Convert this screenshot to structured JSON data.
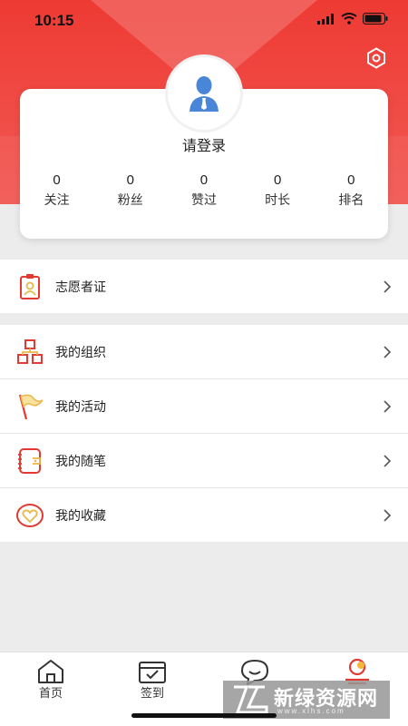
{
  "status_bar": {
    "time": "10:15"
  },
  "colors": {
    "brand": "#ee3a33",
    "brand_light": "#f47f7c",
    "icon_gold": "#e8b84a",
    "avatar_blue": "#4a86d8"
  },
  "profile": {
    "avatar_icon": "user-icon",
    "login_label": "请登录",
    "stats": [
      {
        "value": "0",
        "label": "关注"
      },
      {
        "value": "0",
        "label": "粉丝"
      },
      {
        "value": "0",
        "label": "赞过"
      },
      {
        "value": "0",
        "label": "时长"
      },
      {
        "value": "0",
        "label": "排名"
      }
    ]
  },
  "settings": {
    "icon": "gear-icon"
  },
  "menu": {
    "certificate": {
      "label": "志愿者证",
      "icon": "id-badge-icon"
    },
    "items": [
      {
        "label": "我的组织",
        "icon": "org-chart-icon"
      },
      {
        "label": "我的活动",
        "icon": "flag-icon"
      },
      {
        "label": "我的随笔",
        "icon": "notebook-icon"
      },
      {
        "label": "我的收藏",
        "icon": "heart-icon"
      }
    ]
  },
  "tabbar": {
    "tabs": [
      {
        "label": "首页",
        "icon": "home-icon"
      },
      {
        "label": "签到",
        "icon": "checkin-icon"
      },
      {
        "label": "",
        "icon": "chat-icon"
      },
      {
        "label": "",
        "icon": "profile-icon"
      }
    ]
  },
  "watermark": {
    "text": "新绿资源网",
    "url": "www.xlhs.com"
  }
}
